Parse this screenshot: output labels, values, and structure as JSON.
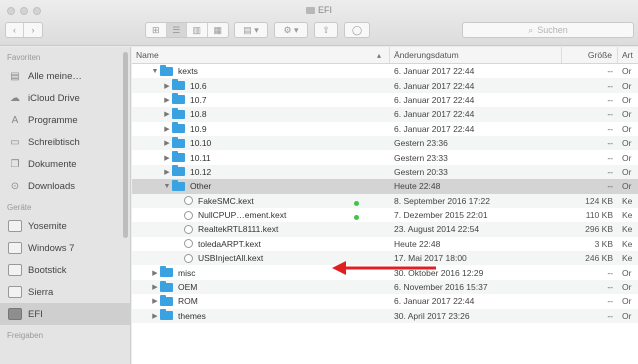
{
  "window": {
    "title": "EFI"
  },
  "toolbar": {
    "back": "‹",
    "forward": "›",
    "view_icons": [
      "⊞",
      "☰",
      "▥",
      "▦"
    ],
    "group_label": "▤ ▾",
    "action_label": "⚙ ▾",
    "share_label": "⇧",
    "tags_label": "◯",
    "search_placeholder": "Suchen"
  },
  "sidebar": {
    "favorites_header": "Favoriten",
    "favorites": [
      {
        "label": "Alle meine…",
        "icon": "all-files-icon",
        "glyph": "▤"
      },
      {
        "label": "iCloud Drive",
        "icon": "cloud-icon",
        "glyph": "☁"
      },
      {
        "label": "Programme",
        "icon": "apps-icon",
        "glyph": "A"
      },
      {
        "label": "Schreibtisch",
        "icon": "desktop-icon",
        "glyph": "▭"
      },
      {
        "label": "Dokumente",
        "icon": "documents-icon",
        "glyph": "❐"
      },
      {
        "label": "Downloads",
        "icon": "downloads-icon",
        "glyph": "⊙"
      }
    ],
    "devices_header": "Geräte",
    "devices": [
      {
        "label": "Yosemite",
        "icon": "disk-icon"
      },
      {
        "label": "Windows 7",
        "icon": "disk-icon"
      },
      {
        "label": "Bootstick",
        "icon": "disk-icon"
      },
      {
        "label": "Sierra",
        "icon": "disk-icon"
      },
      {
        "label": "EFI",
        "icon": "usb-disk-icon",
        "selected": true
      }
    ],
    "shared_header": "Freigaben"
  },
  "columns": {
    "name": "Name",
    "date": "Änderungsdatum",
    "size": "Größe",
    "kind": "Art",
    "sort_indicator": "▴"
  },
  "rows": [
    {
      "name": "kexts",
      "type": "folder",
      "level": 1,
      "expanded": true,
      "date": "6. Januar 2017 22:44",
      "size": "--",
      "kind": "Or"
    },
    {
      "name": "10.6",
      "type": "folder",
      "level": 2,
      "expanded": false,
      "date": "6. Januar 2017 22:44",
      "size": "--",
      "kind": "Or"
    },
    {
      "name": "10.7",
      "type": "folder",
      "level": 2,
      "expanded": false,
      "date": "6. Januar 2017 22:44",
      "size": "--",
      "kind": "Or"
    },
    {
      "name": "10.8",
      "type": "folder",
      "level": 2,
      "expanded": false,
      "date": "6. Januar 2017 22:44",
      "size": "--",
      "kind": "Or"
    },
    {
      "name": "10.9",
      "type": "folder",
      "level": 2,
      "expanded": false,
      "date": "6. Januar 2017 22:44",
      "size": "--",
      "kind": "Or"
    },
    {
      "name": "10.10",
      "type": "folder",
      "level": 2,
      "expanded": false,
      "date": "Gestern 23:36",
      "size": "--",
      "kind": "Or"
    },
    {
      "name": "10.11",
      "type": "folder",
      "level": 2,
      "expanded": false,
      "date": "Gestern 23:33",
      "size": "--",
      "kind": "Or"
    },
    {
      "name": "10.12",
      "type": "folder",
      "level": 2,
      "expanded": false,
      "date": "Gestern 20:33",
      "size": "--",
      "kind": "Or"
    },
    {
      "name": "Other",
      "type": "folder",
      "level": 2,
      "expanded": true,
      "selected": true,
      "date": "Heute 22:48",
      "size": "--",
      "kind": "Or"
    },
    {
      "name": "FakeSMC.kext",
      "type": "kext",
      "level": 3,
      "tag": true,
      "date": "8. September 2016 17:22",
      "size": "124 KB",
      "kind": "Ke"
    },
    {
      "name": "NullCPUP…ement.kext",
      "type": "kext",
      "level": 3,
      "tag": true,
      "date": "7. Dezember 2015 22:01",
      "size": "110 KB",
      "kind": "Ke"
    },
    {
      "name": "RealtekRTL8111.kext",
      "type": "kext",
      "level": 3,
      "date": "23. August 2014 22:54",
      "size": "296 KB",
      "kind": "Ke"
    },
    {
      "name": "toledaARPT.kext",
      "type": "kext",
      "level": 3,
      "date": "Heute 22:48",
      "size": "3 KB",
      "kind": "Ke",
      "dim_date": true
    },
    {
      "name": "USBInjectAll.kext",
      "type": "kext",
      "level": 3,
      "date": "17. Mai 2017 18:00",
      "size": "246 KB",
      "kind": "Ke"
    },
    {
      "name": "misc",
      "type": "folder",
      "level": 1,
      "expanded": false,
      "date": "30. Oktober 2016 12:29",
      "size": "--",
      "kind": "Or"
    },
    {
      "name": "OEM",
      "type": "folder",
      "level": 1,
      "expanded": false,
      "date": "6. November 2016 15:37",
      "size": "--",
      "kind": "Or"
    },
    {
      "name": "ROM",
      "type": "folder",
      "level": 1,
      "expanded": false,
      "date": "6. Januar 2017 22:44",
      "size": "--",
      "kind": "Or"
    },
    {
      "name": "themes",
      "type": "folder",
      "level": 1,
      "expanded": false,
      "date": "30. April 2017 23:26",
      "size": "--",
      "kind": "Or"
    }
  ],
  "colors": {
    "folder": "#3aa2e0",
    "tag_green": "#42c24a",
    "arrow_red": "#e02020",
    "selection": "#d4d4d4"
  }
}
